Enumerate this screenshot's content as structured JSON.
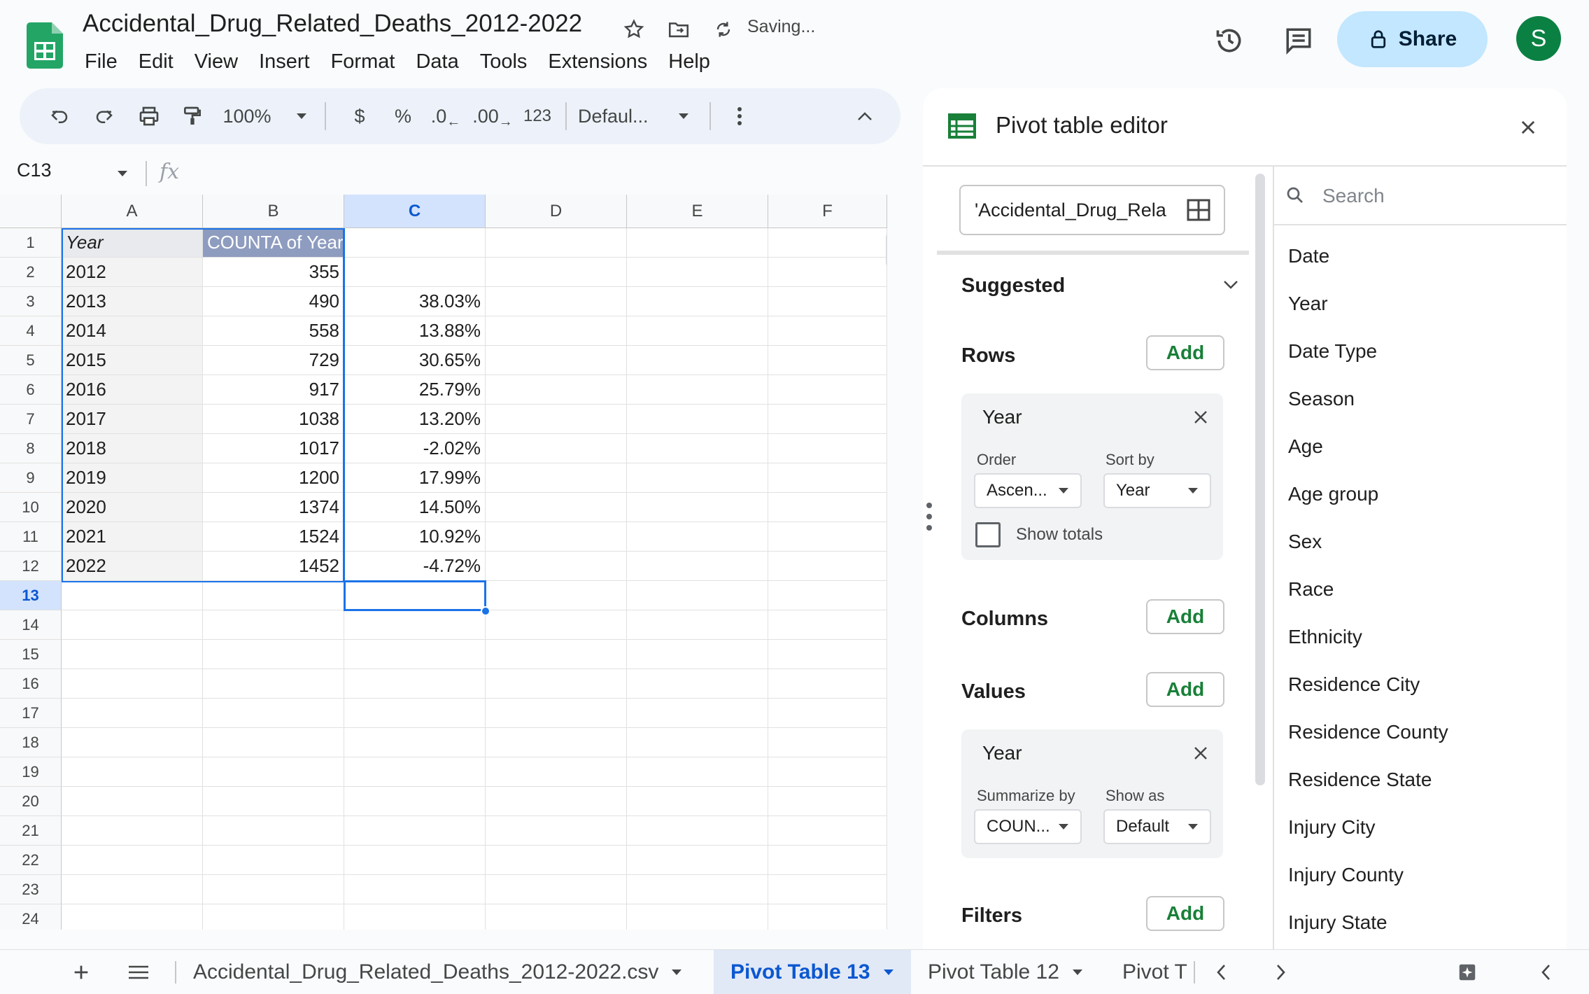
{
  "doc": {
    "title": "Accidental_Drug_Related_Deaths_2012-2022",
    "status": "Saving..."
  },
  "menu": [
    "File",
    "Edit",
    "View",
    "Insert",
    "Format",
    "Data",
    "Tools",
    "Extensions",
    "Help"
  ],
  "header": {
    "share_label": "Share",
    "avatar_initial": "S"
  },
  "toolbar": {
    "zoom": "100%",
    "currency": "$",
    "percent": "%",
    "dec_less": ".0",
    "dec_more": ".00",
    "number_format": "123",
    "font": "Defaul..."
  },
  "formula_bar": {
    "cell_ref": "C13",
    "fx": "fx"
  },
  "grid": {
    "columns": [
      "A",
      "B",
      "C",
      "D",
      "E",
      "F"
    ],
    "rows": [
      "1",
      "2",
      "3",
      "4",
      "5",
      "6",
      "7",
      "8",
      "9",
      "10",
      "11",
      "12",
      "13",
      "14",
      "15",
      "16",
      "17",
      "18",
      "19",
      "20",
      "21",
      "22",
      "23",
      "24"
    ],
    "header_a": "Year",
    "header_b": "COUNTA of Year",
    "data": [
      {
        "year": "2012",
        "count": "355",
        "pct": ""
      },
      {
        "year": "2013",
        "count": "490",
        "pct": "38.03%"
      },
      {
        "year": "2014",
        "count": "558",
        "pct": "13.88%"
      },
      {
        "year": "2015",
        "count": "729",
        "pct": "30.65%"
      },
      {
        "year": "2016",
        "count": "917",
        "pct": "25.79%"
      },
      {
        "year": "2017",
        "count": "1038",
        "pct": "13.20%"
      },
      {
        "year": "2018",
        "count": "1017",
        "pct": "-2.02%"
      },
      {
        "year": "2019",
        "count": "1200",
        "pct": "17.99%"
      },
      {
        "year": "2020",
        "count": "1374",
        "pct": "14.50%"
      },
      {
        "year": "2021",
        "count": "1524",
        "pct": "10.92%"
      },
      {
        "year": "2022",
        "count": "1452",
        "pct": "-4.72%"
      }
    ]
  },
  "panel": {
    "title": "Pivot table editor",
    "range": "'Accidental_Drug_Rela",
    "suggested": "Suggested",
    "rows_label": "Rows",
    "columns_label": "Columns",
    "values_label": "Values",
    "filters_label": "Filters",
    "add_label": "Add",
    "row_card": {
      "title": "Year",
      "order_label": "Order",
      "order_value": "Ascen...",
      "sortby_label": "Sort by",
      "sortby_value": "Year",
      "show_totals": "Show totals"
    },
    "value_card": {
      "title": "Year",
      "summarize_label": "Summarize by",
      "summarize_value": "COUN...",
      "showas_label": "Show as",
      "showas_value": "Default"
    },
    "search_placeholder": "Search",
    "fields": [
      "Date",
      "Year",
      "Date Type",
      "Season",
      "Age",
      "Age group",
      "Sex",
      "Race",
      "Ethnicity",
      "Residence City",
      "Residence County",
      "Residence State",
      "Injury City",
      "Injury County",
      "Injury State"
    ]
  },
  "tabs": [
    "Accidental_Drug_Related_Deaths_2012-2022.csv",
    "Pivot Table 13",
    "Pivot Table 12",
    "Pivot T"
  ],
  "colors": {
    "accent": "#1a73e8",
    "share_bg": "#c2e7ff",
    "pivot_header": "#8e9cbf",
    "green": "#188038"
  }
}
